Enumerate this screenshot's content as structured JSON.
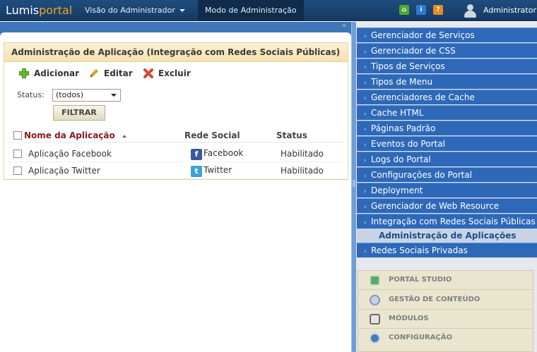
{
  "topbar": {
    "logo_part1": "Lumis",
    "logo_part2": "portal",
    "nav_admin_view": "Visão do Administrador",
    "nav_admin_mode": "Modo de Administração",
    "user_name": "Administrator",
    "icons": [
      "home-icon",
      "info-icon",
      "help-icon"
    ]
  },
  "portlet": {
    "title": "Administração de Aplicação (Integração com Redes Sociais Públicas)",
    "toolbar": {
      "add_label": "Adicionar",
      "edit_label": "Editar",
      "delete_label": "Excluir"
    },
    "filter": {
      "status_label": "Status:",
      "status_value": "(todos)",
      "filter_button": "FILTRAR"
    },
    "table": {
      "columns": [
        "Nome da Aplicação",
        "Rede Social",
        "Status"
      ],
      "rows": [
        {
          "name": "Aplicação Facebook",
          "social": "Facebook",
          "status": "Habilitado"
        },
        {
          "name": "Aplicação Twitter",
          "social": "Twitter",
          "status": "Habilitado"
        }
      ]
    }
  },
  "sidebar": {
    "items": [
      "Gerenciador de Serviços",
      "Gerenciador de CSS",
      "Tipos de Serviços",
      "Tipos de Menu",
      "Gerenciadores de Cache",
      "Cache HTML",
      "Páginas Padrão",
      "Eventos do Portal",
      "Logs do Portal",
      "Configurações do Portal",
      "Deployment",
      "Gerenciador de Web Resource",
      "Integração com Redes Sociais Públicas"
    ],
    "selected_sub": "Administração de Aplicações",
    "after_sub": "Redes Sociais Privadas",
    "panel": [
      "PORTAL STUDIO",
      "GESTÃO DE CONTEÚDO",
      "MÓDULOS",
      "CONFIGURAÇÃO"
    ]
  },
  "colors": {
    "topbar": "#1f4d80",
    "menu_item": "#2d69b8",
    "portlet_header": "#f6e2b0",
    "sort_column": "#8a1a1a"
  }
}
